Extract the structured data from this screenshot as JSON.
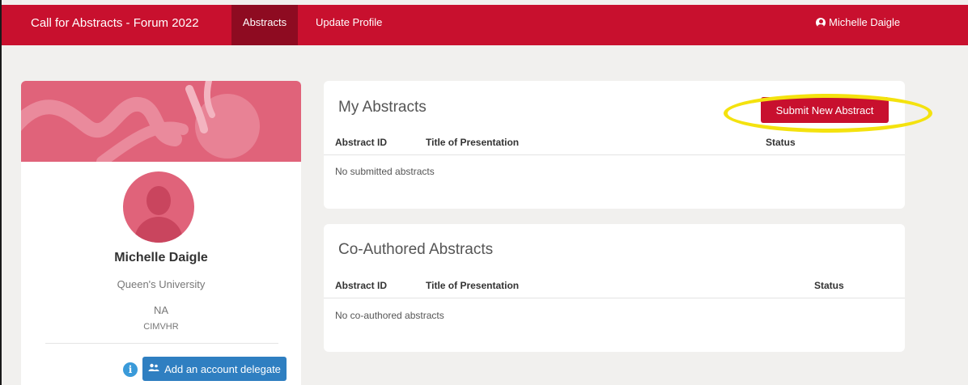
{
  "nav": {
    "brand": "Call for Abstracts - Forum 2022",
    "abstracts": "Abstracts",
    "update_profile": "Update Profile",
    "user": "Michelle Daigle"
  },
  "profile": {
    "name": "Michelle Daigle",
    "organization": "Queen's University",
    "field1": "NA",
    "field2": "CIMVHR",
    "info_glyph": "i",
    "delegate_button": "Add an account delegate"
  },
  "my_abstracts": {
    "title": "My Abstracts",
    "submit_button": "Submit New Abstract",
    "columns": [
      "Abstract ID",
      "Title of Presentation",
      "Status"
    ],
    "empty_message": "No submitted abstracts"
  },
  "co_authored": {
    "title": "Co-Authored Abstracts",
    "columns": [
      "Abstract ID",
      "Title of Presentation",
      "Status"
    ],
    "empty_message": "No co-authored abstracts"
  },
  "colors": {
    "brand": "#c8102e",
    "brand_dark": "#8e0b21",
    "banner": "#e0637a",
    "delegate_button": "#2f7fc1",
    "highlight": "#f4e20e"
  },
  "icons": [
    "user-circle-icon",
    "info-icon",
    "users-icon"
  ]
}
